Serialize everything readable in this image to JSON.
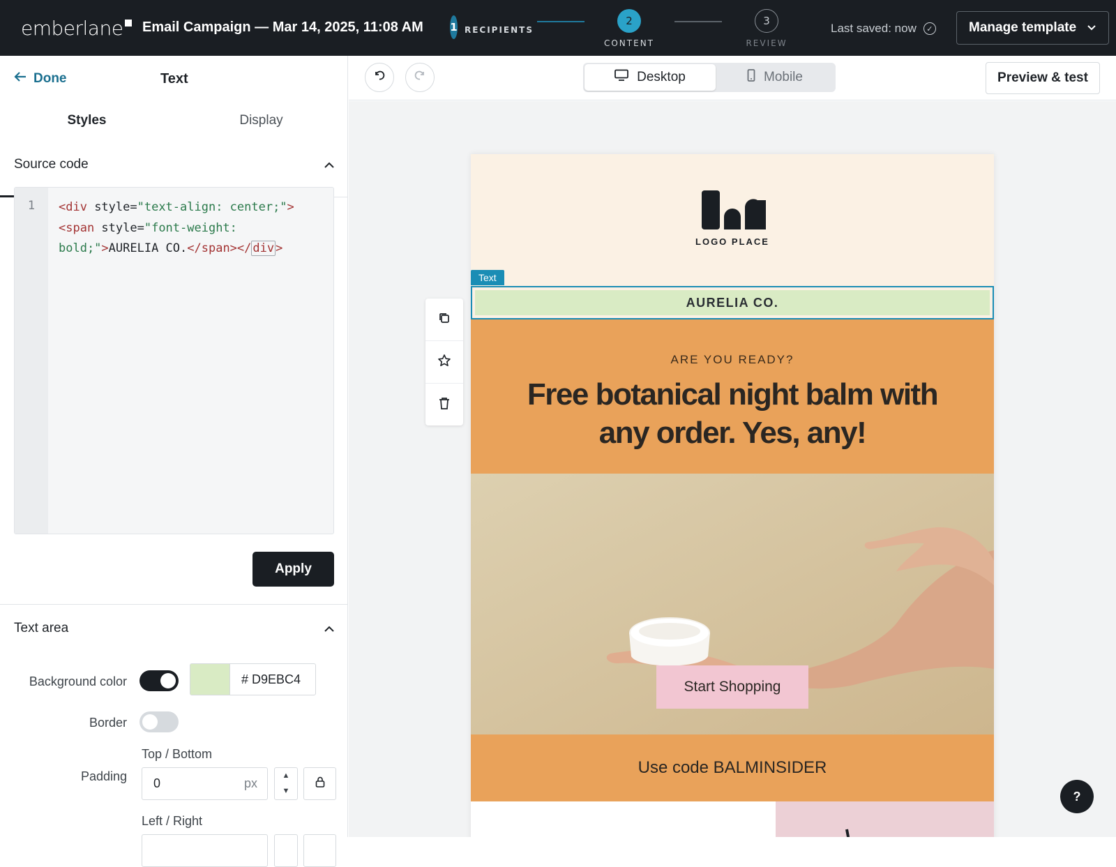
{
  "topbar": {
    "brand": "emberlane",
    "campaign_title": "Email Campaign — Mar 14, 2025, 11:08 AM",
    "steps": [
      {
        "number": "1",
        "label": "RECIPIENTS",
        "state": "done"
      },
      {
        "number": "2",
        "label": "CONTENT",
        "state": "active"
      },
      {
        "number": "3",
        "label": "REVIEW",
        "state": "pending"
      }
    ],
    "saved_status": "Last saved: now",
    "manage_label": "Manage template"
  },
  "panel": {
    "done_label": "Done",
    "title": "Text",
    "tabs": [
      {
        "label": "Styles"
      },
      {
        "label": "Display"
      }
    ],
    "source_section": "Source code",
    "code_line_number": "1",
    "code_tokens": [
      "<div",
      " style=",
      "\"text-align: center;\"",
      ">",
      "<span",
      " style=",
      "\"font-weight: bold;\"",
      ">",
      "AURELIA CO.",
      "</span>",
      "</",
      "div",
      ">"
    ],
    "apply_label": "Apply",
    "text_area_section": "Text area",
    "bg_color_label": "Background color",
    "bg_color_enabled": true,
    "bg_color_hex": "# D9EBC4",
    "bg_color": "#D9EBC4",
    "border_label": "Border",
    "border_enabled": false,
    "padding_label": "Padding",
    "top_bottom_label": "Top / Bottom",
    "top_bottom_value": "0",
    "unit": "px",
    "left_right_label": "Left / Right"
  },
  "editor": {
    "view_desktop": "Desktop",
    "view_mobile": "Mobile",
    "active_view": "Desktop",
    "preview_label": "Preview & test"
  },
  "email": {
    "logo_label": "LOGO PLACE",
    "selection_tag": "Text",
    "brand_text": "AURELIA CO.",
    "kicker": "ARE YOU READY?",
    "headline": "Free botanical night balm with any order. Yes, any!",
    "cta": "Start Shopping",
    "promo": "Use code BALMINSIDER"
  },
  "help_label": "?",
  "colors": {
    "topbar": "#1a1e23",
    "accent": "#1a8db5",
    "email_orange": "#e9a25a",
    "email_cream": "#fbf1e4",
    "cta_pink": "#f2c6d2"
  }
}
